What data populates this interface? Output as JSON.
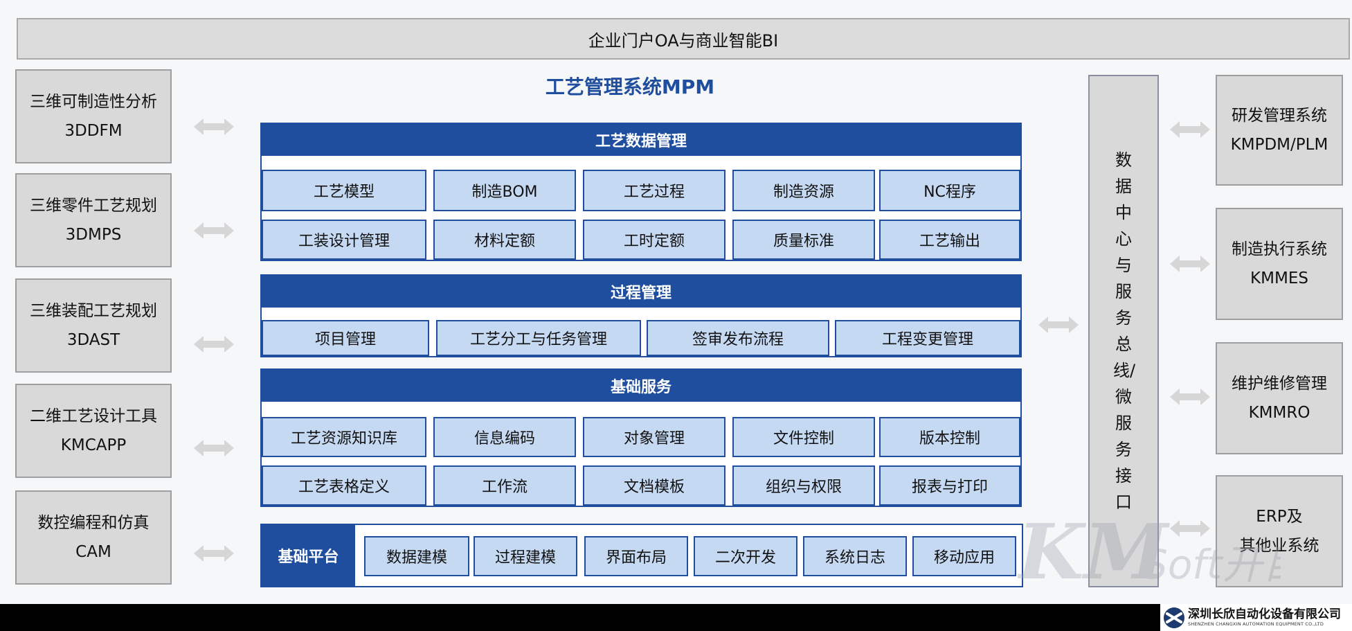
{
  "banner": {
    "title": "企业门户OA与商业智能BI"
  },
  "mpm_title": "工艺管理系统MPM",
  "left_systems": [
    {
      "name": "三维可制造性分析",
      "code": "3DDFM"
    },
    {
      "name": "三维零件工艺规划",
      "code": "3DMPS"
    },
    {
      "name": "三维装配工艺规划",
      "code": "3DAST"
    },
    {
      "name": "二维工艺设计工具",
      "code": "KMCAPP"
    },
    {
      "name": "数控编程和仿真",
      "code": "CAM"
    }
  ],
  "right_systems": [
    {
      "name": "研发管理系统",
      "code": "KMPDM/PLM"
    },
    {
      "name": "制造执行系统",
      "code": "KMMES"
    },
    {
      "name": "维护维修管理",
      "code": "KMMRO"
    },
    {
      "name": "ERP及",
      "code": "其他业系统"
    }
  ],
  "sections": {
    "process_data": {
      "title": "工艺数据管理",
      "items": [
        "工艺模型",
        "制造BOM",
        "工艺过程",
        "制造资源",
        "NC程序",
        "工装设计管理",
        "材料定额",
        "工时定额",
        "质量标准",
        "工艺输出"
      ]
    },
    "process_mgmt": {
      "title": "过程管理",
      "items": [
        "项目管理",
        "工艺分工与任务管理",
        "签审发布流程",
        "工程变更管理"
      ]
    },
    "base_services": {
      "title": "基础服务",
      "items": [
        "工艺资源知识库",
        "信息编码",
        "对象管理",
        "文件控制",
        "版本控制",
        "工艺表格定义",
        "工作流",
        "文档模板",
        "组织与权限",
        "报表与打印"
      ]
    }
  },
  "platform": {
    "label": "基础平台",
    "items": [
      "数据建模",
      "过程建模",
      "界面布局",
      "二次开发",
      "系统日志",
      "移动应用"
    ]
  },
  "bus": {
    "text": "数据中心与服务总线/微服务接口"
  },
  "watermark": "KMSoft开目",
  "company": {
    "name_cn": "深圳长欣自动化设备有限公司",
    "name_en": "SHENZHEN CHANGXIN AUTOMATION EQUIPMENT CO.,LTD"
  },
  "colors": {
    "accent": "#1f4e9e",
    "cell_fill": "#c6d9f3",
    "side_fill": "#d9d9d9"
  }
}
